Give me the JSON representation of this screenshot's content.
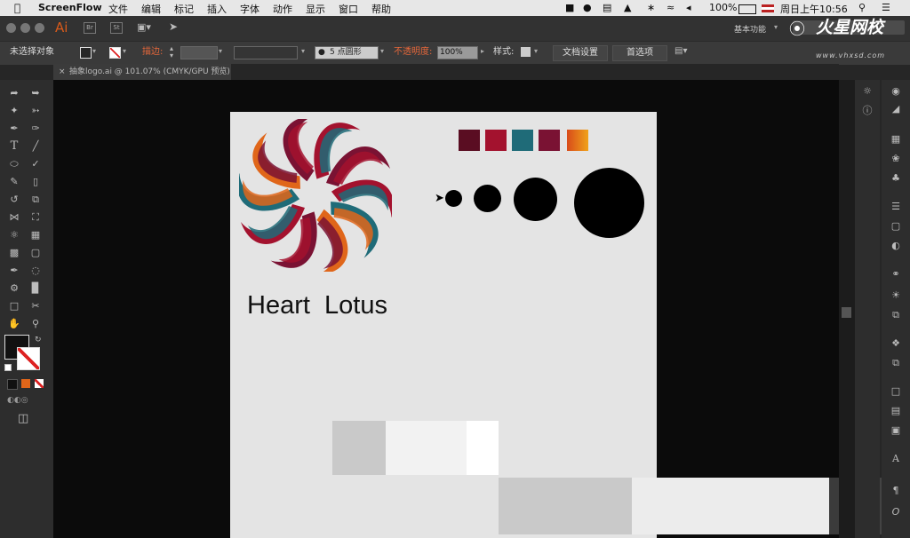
{
  "menubar": {
    "app": "ScreenFlow",
    "items": [
      "文件",
      "编辑",
      "标记",
      "插入",
      "字体",
      "动作",
      "显示",
      "窗口",
      "帮助"
    ],
    "battery": "100%",
    "clock": "周日上午10:56"
  },
  "appbar": {
    "logo": "Ai",
    "badge_br": "Br",
    "badge_st": "St",
    "workspace_label": "基本功能",
    "watermark": "火星网校",
    "watermark_url": "www.vhxsd.com"
  },
  "control": {
    "no_selection": "未选择对象",
    "stroke_label": "描边:",
    "brush": "5 点圆形",
    "opacity_label": "不透明度:",
    "opacity_value": "100%",
    "style_label": "样式:",
    "doc_settings": "文档设置",
    "preferences": "首选项"
  },
  "tab": {
    "close": "×",
    "title": "抽象logo.ai @ 101.07% (CMYK/GPU 预览)"
  },
  "artboard": {
    "logo_text": "Heart  Lotus"
  },
  "colors": {
    "swatches": [
      "#5a0d22",
      "#a3122e",
      "#1f6b78",
      "#7a1233",
      "#e77a16"
    ],
    "petal_dark": "#7a1233",
    "petal_red": "#a3122e",
    "petal_teal": "#1f6b78",
    "petal_orange": "#e0661a"
  }
}
